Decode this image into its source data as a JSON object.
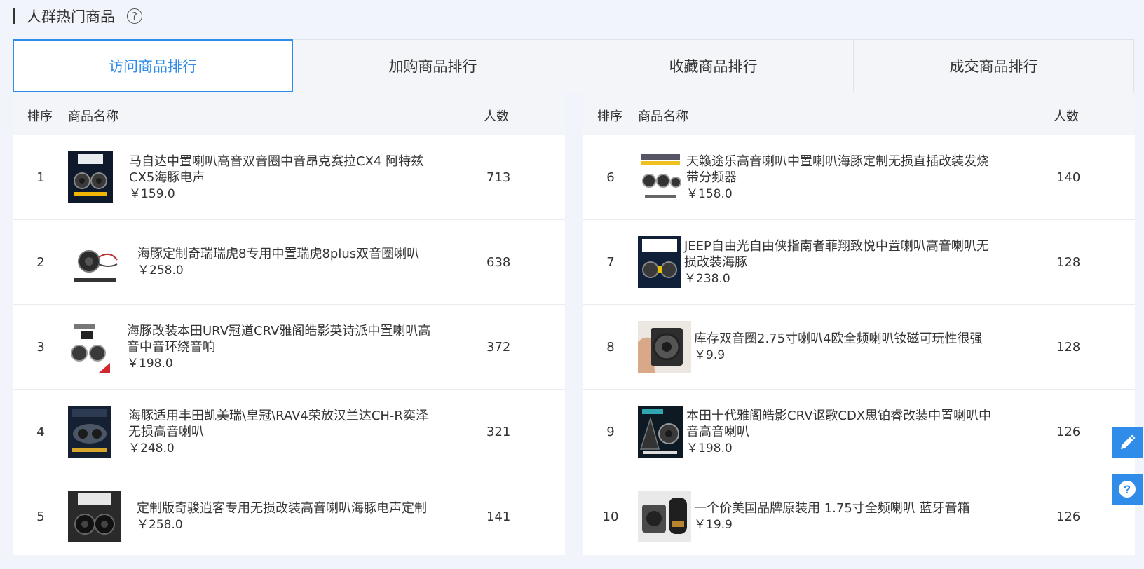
{
  "header": {
    "title": "人群热门商品",
    "help_icon": "question-circle-icon"
  },
  "tabs": [
    {
      "label": "访问商品排行",
      "active": true
    },
    {
      "label": "加购商品排行",
      "active": false
    },
    {
      "label": "收藏商品排行",
      "active": false
    },
    {
      "label": "成交商品排行",
      "active": false
    }
  ],
  "table_headers": {
    "rank": "排序",
    "name": "商品名称",
    "count": "人数"
  },
  "left_rows": [
    {
      "rank": "1",
      "name": "马自达中置喇叭高音双音圈中音昂克赛拉CX4 阿特兹CX5海豚电声",
      "price": "￥159.0",
      "count": "713"
    },
    {
      "rank": "2",
      "name": "海豚定制奇瑞瑞虎8专用中置瑞虎8plus双音圈喇叭",
      "price": "￥258.0",
      "count": "638"
    },
    {
      "rank": "3",
      "name": "海豚改装本田URV冠道CRV雅阁皓影英诗派中置喇叭高音中音环绕音响",
      "price": "￥198.0",
      "count": "372"
    },
    {
      "rank": "4",
      "name": "海豚适用丰田凯美瑞\\皇冠\\RAV4荣放汉兰达CH-R奕泽无损高音喇叭",
      "price": "￥248.0",
      "count": "321"
    },
    {
      "rank": "5",
      "name": "定制版奇骏逍客专用无损改装高音喇叭海豚电声定制",
      "price": "￥258.0",
      "count": "141"
    }
  ],
  "right_rows": [
    {
      "rank": "6",
      "name": "天籁途乐高音喇叭中置喇叭海豚定制无损直插改装发烧带分频器",
      "price": "￥158.0",
      "count": "140"
    },
    {
      "rank": "7",
      "name": "JEEP自由光自由侠指南者菲翔致悦中置喇叭高音喇叭无损改装海豚",
      "price": "￥238.0",
      "count": "128"
    },
    {
      "rank": "8",
      "name": "库存双音圈2.75寸喇叭4欧全频喇叭钕磁可玩性很强",
      "price": "￥9.9",
      "count": "128"
    },
    {
      "rank": "9",
      "name": "本田十代雅阁皓影CRV讴歌CDX思铂睿改装中置喇叭中音高音喇叭",
      "price": "￥198.0",
      "count": "126"
    },
    {
      "rank": "10",
      "name": "一个价美国品牌原装用 1.75寸全频喇叭 蓝牙音箱",
      "price": "￥19.9",
      "count": "126"
    }
  ],
  "floating": {
    "edit_icon": "pencil-icon",
    "help_icon": "question-circle-icon"
  },
  "colors": {
    "accent": "#2f8ce8",
    "background": "#f1f5fb"
  }
}
